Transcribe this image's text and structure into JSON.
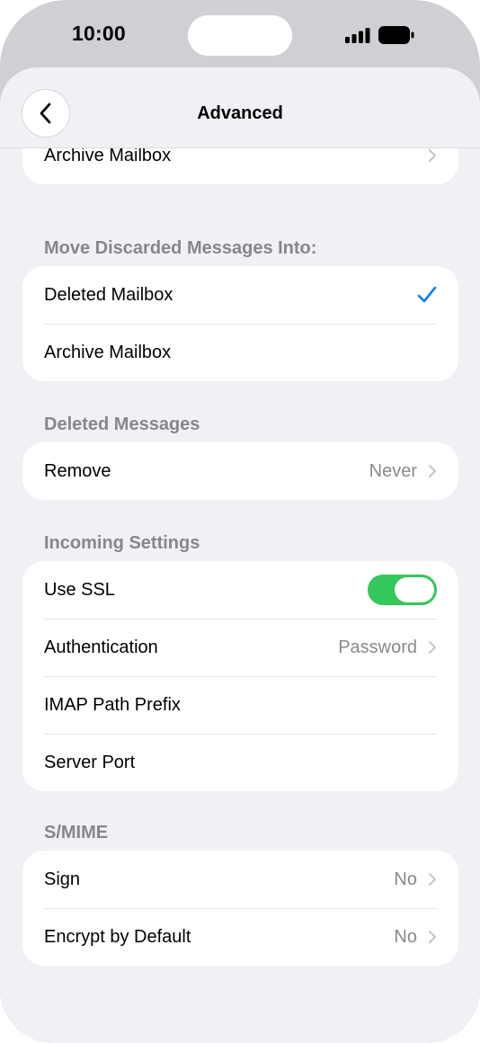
{
  "status_bar": {
    "time": "10:00"
  },
  "nav": {
    "title": "Advanced"
  },
  "archive_section": {
    "rows": [
      {
        "label": "Archive Mailbox"
      }
    ]
  },
  "discard_section": {
    "header": "Move Discarded Messages Into:",
    "rows": [
      {
        "label": "Deleted Mailbox",
        "selected": true
      },
      {
        "label": "Archive Mailbox",
        "selected": false
      }
    ]
  },
  "deleted_section": {
    "header": "Deleted Messages",
    "rows": [
      {
        "label": "Remove",
        "value": "Never"
      }
    ]
  },
  "incoming_section": {
    "header": "Incoming Settings",
    "rows": [
      {
        "label": "Use SSL",
        "toggle_on": true
      },
      {
        "label": "Authentication",
        "value": "Password"
      },
      {
        "label": "IMAP Path Prefix"
      },
      {
        "label": "Server Port"
      }
    ]
  },
  "smime_section": {
    "header": "S/MIME",
    "rows": [
      {
        "label": "Sign",
        "value": "No"
      },
      {
        "label": "Encrypt by Default",
        "value": "No"
      }
    ]
  },
  "colors": {
    "accent": "#007aff",
    "toggle_on": "#34c759",
    "background": "#f0f0f5",
    "secondary_text": "#8a8a8e"
  }
}
